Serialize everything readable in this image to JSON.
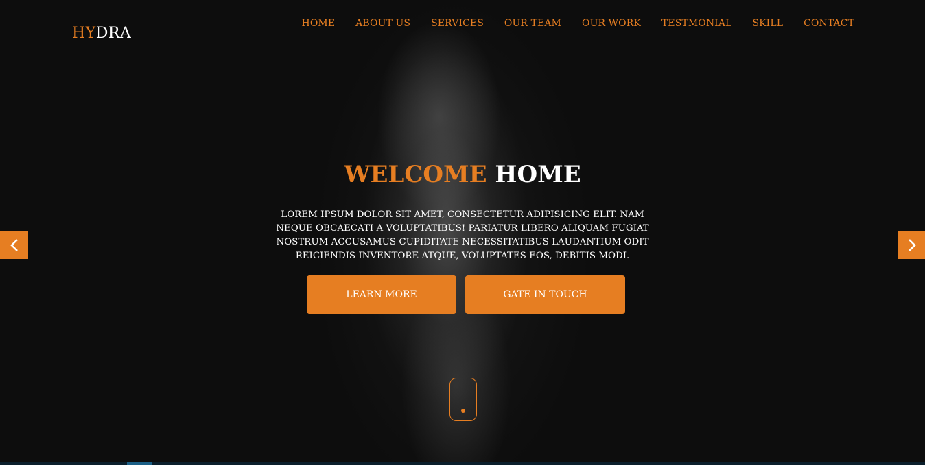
{
  "brand": {
    "part1": "HY",
    "part2": "DRA"
  },
  "nav": {
    "items": [
      "HOME",
      "ABOUT US",
      "SERVICES",
      "OUR TEAM",
      "OUR WORK",
      "TESTMONIAL",
      "SKILL",
      "CONTACT"
    ]
  },
  "hero": {
    "title_part1": "WELCOME",
    "title_part2": "HOME",
    "lead": "LOREM IPSUM DOLOR SIT AMET, CONSECTETUR ADIPISICING ELIT. NAM NEQUE OBCAECATI A VOLUPTATIBUS! PARIATUR LIBERO ALIQUAM FUGIAT NOSTRUM ACCUSAMUS CUPIDITATE NECESSITATIBUS LAUDANTIUM ODIT REICIENDIS INVENTORE ATQUE, VOLUPTATES EOS, DEBITIS MODI.",
    "learn_more": "LEARN MORE",
    "get_in_touch": "GATE IN TOUCH"
  },
  "icons": {
    "prev": "chevron-left-icon",
    "next": "chevron-right-icon",
    "scroll": "scroll-mouse-icon"
  },
  "colors": {
    "accent": "#e67e22",
    "background": "#0d0d0d",
    "text": "#ffffff"
  }
}
